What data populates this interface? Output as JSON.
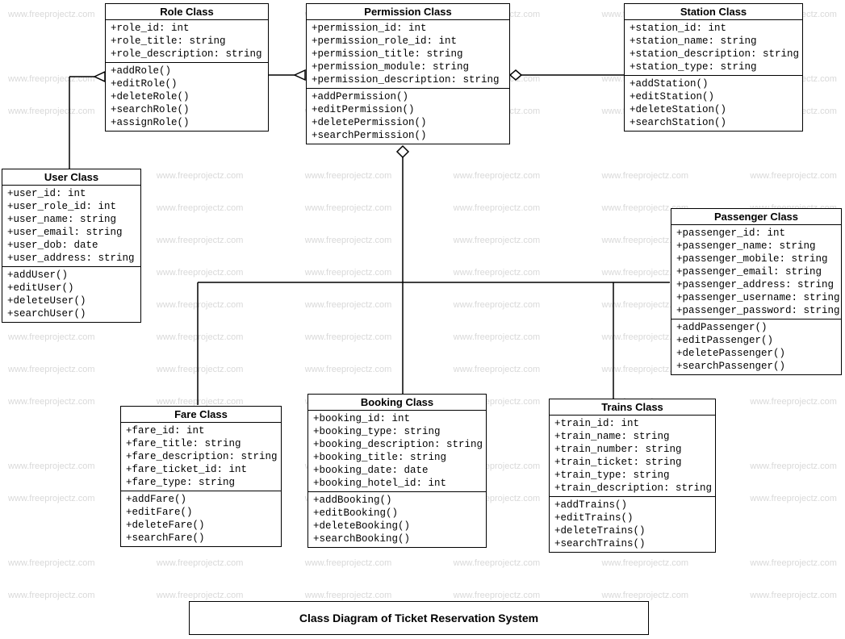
{
  "title": "Class Diagram of Ticket Reservation System",
  "watermark": "www.freeprojectz.com",
  "classes": {
    "role": {
      "name": "Role Class",
      "attrs": [
        "+role_id: int",
        "+role_title: string",
        "+role_description: string"
      ],
      "ops": [
        "+addRole()",
        "+editRole()",
        "+deleteRole()",
        "+searchRole()",
        "+assignRole()"
      ]
    },
    "permission": {
      "name": "Permission Class",
      "attrs": [
        "+permission_id: int",
        "+permission_role_id: int",
        "+permission_title: string",
        "+permission_module: string",
        "+permission_description: string"
      ],
      "ops": [
        "+addPermission()",
        "+editPermission()",
        "+deletePermission()",
        "+searchPermission()"
      ]
    },
    "station": {
      "name": "Station Class",
      "attrs": [
        "+station_id: int",
        "+station_name: string",
        "+station_description: string",
        "+station_type: string"
      ],
      "ops": [
        "+addStation()",
        "+editStation()",
        "+deleteStation()",
        "+searchStation()"
      ]
    },
    "user": {
      "name": "User Class",
      "attrs": [
        "+user_id: int",
        "+user_role_id: int",
        "+user_name: string",
        "+user_email: string",
        "+user_dob: date",
        "+user_address: string"
      ],
      "ops": [
        "+addUser()",
        "+editUser()",
        "+deleteUser()",
        "+searchUser()"
      ]
    },
    "passenger": {
      "name": "Passenger Class",
      "attrs": [
        "+passenger_id: int",
        "+passenger_name: string",
        "+passenger_mobile: string",
        "+passenger_email: string",
        "+passenger_address: string",
        "+passenger_username: string",
        "+passenger_password: string"
      ],
      "ops": [
        "+addPassenger()",
        "+editPassenger()",
        "+deletePassenger()",
        "+searchPassenger()"
      ]
    },
    "fare": {
      "name": "Fare Class",
      "attrs": [
        "+fare_id: int",
        "+fare_title: string",
        "+fare_description: string",
        "+fare_ticket_id: int",
        "+fare_type: string"
      ],
      "ops": [
        "+addFare()",
        "+editFare()",
        "+deleteFare()",
        "+searchFare()"
      ]
    },
    "booking": {
      "name": "Booking Class",
      "attrs": [
        "+booking_id: int",
        "+booking_type: string",
        "+booking_description: string",
        "+booking_title: string",
        "+booking_date: date",
        "+booking_hotel_id: int"
      ],
      "ops": [
        "+addBooking()",
        "+editBooking()",
        "+deleteBooking()",
        "+searchBooking()"
      ]
    },
    "trains": {
      "name": "Trains Class",
      "attrs": [
        "+train_id: int",
        "+train_name: string",
        "+train_number: string",
        "+train_ticket: string",
        "+train_type: string",
        "+train_description: string"
      ],
      "ops": [
        "+addTrains()",
        "+editTrains()",
        "+deleteTrains()",
        "+searchTrains()"
      ]
    }
  }
}
